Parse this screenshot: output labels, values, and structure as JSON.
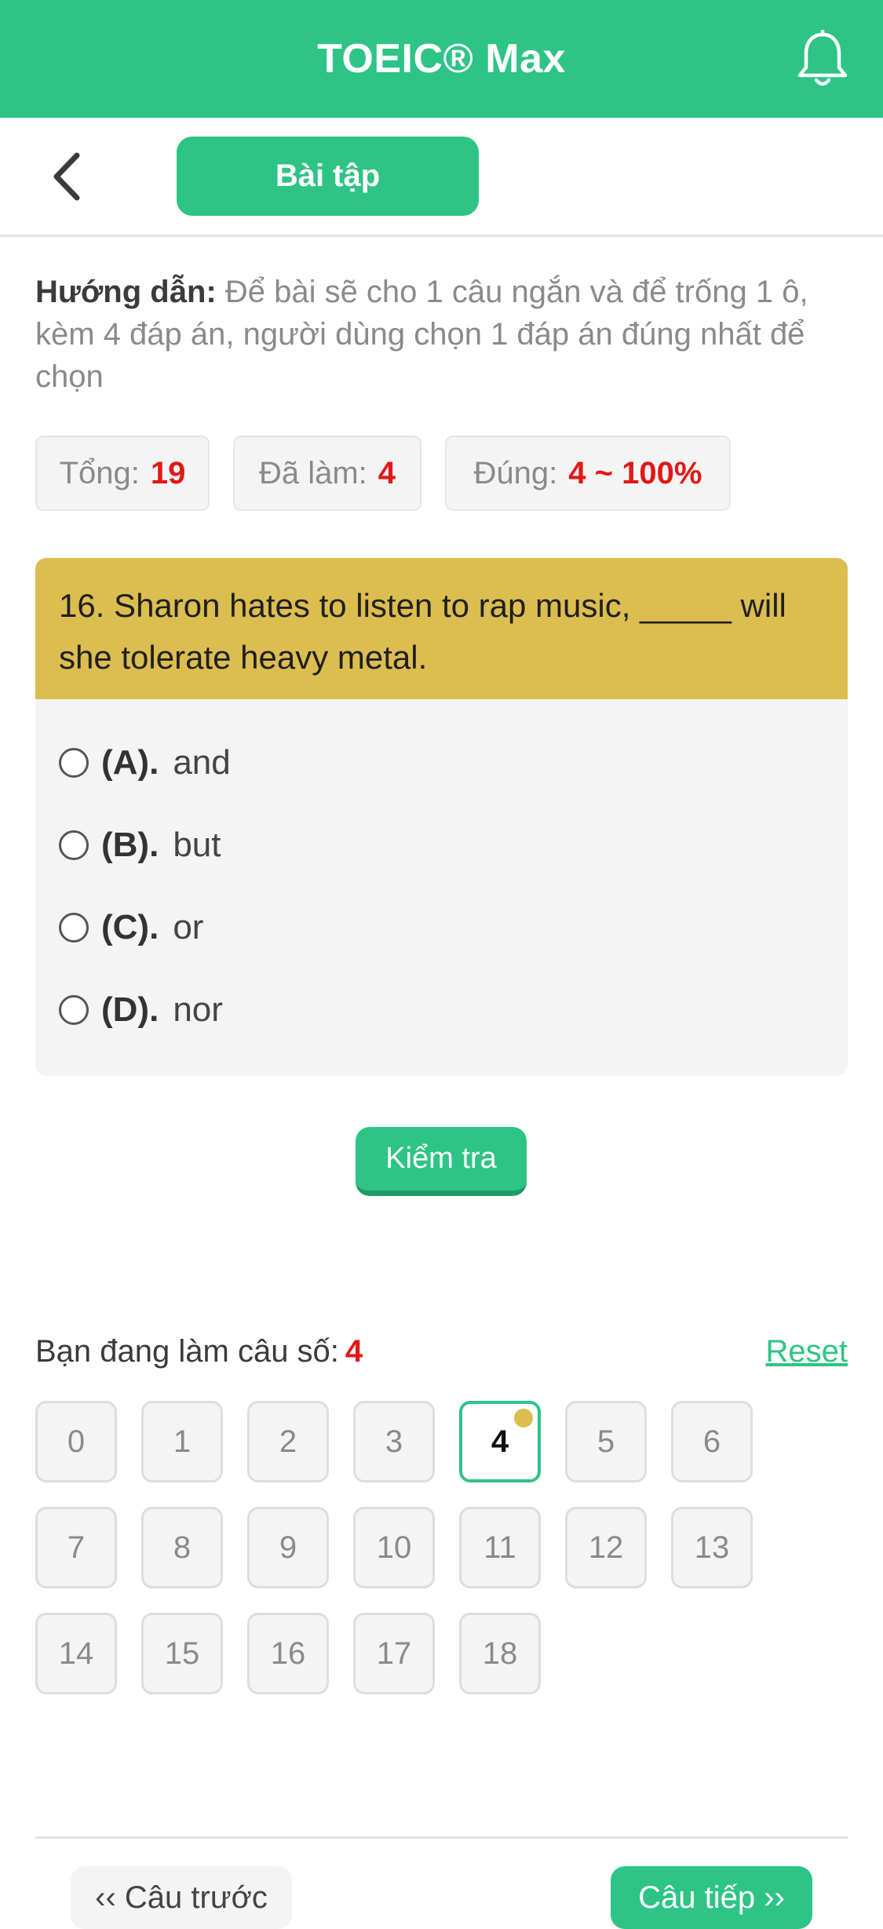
{
  "header": {
    "title": "TOEIC® Max",
    "bell_icon": "bell-icon"
  },
  "subbar": {
    "back_icon": "chevron-left-icon",
    "tab_label": "Bài tập"
  },
  "instructions": {
    "label": "Hướng dẫn:",
    "text": "Để bài sẽ cho 1 câu ngắn và để trống 1 ô, kèm 4 đáp án, người dùng chọn 1 đáp án đúng nhất để chọn"
  },
  "stats": {
    "total_label": "Tổng:",
    "total_value": "19",
    "done_label": "Đã làm:",
    "done_value": "4",
    "correct_label": "Đúng:",
    "correct_value": "4 ~ 100%"
  },
  "question": {
    "text": "16. Sharon hates to listen to rap music, _____ will she tolerate heavy metal.",
    "options": [
      {
        "letter": "(A).",
        "text": "and"
      },
      {
        "letter": "(B).",
        "text": "but"
      },
      {
        "letter": "(C).",
        "text": "or"
      },
      {
        "letter": "(D).",
        "text": "nor"
      }
    ]
  },
  "check_button": "Kiểm tra",
  "progress": {
    "label": "Bạn đang làm câu số:",
    "current": "4",
    "reset": "Reset"
  },
  "question_numbers": [
    "0",
    "1",
    "2",
    "3",
    "4",
    "5",
    "6",
    "7",
    "8",
    "9",
    "10",
    "11",
    "12",
    "13",
    "14",
    "15",
    "16",
    "17",
    "18"
  ],
  "current_index": 4,
  "nav": {
    "prev": "‹‹ Câu trước",
    "next": "Câu tiếp ››"
  },
  "colors": {
    "brand": "#2ec486",
    "question_header": "#dcbd4f",
    "accent_red": "#e21818"
  }
}
